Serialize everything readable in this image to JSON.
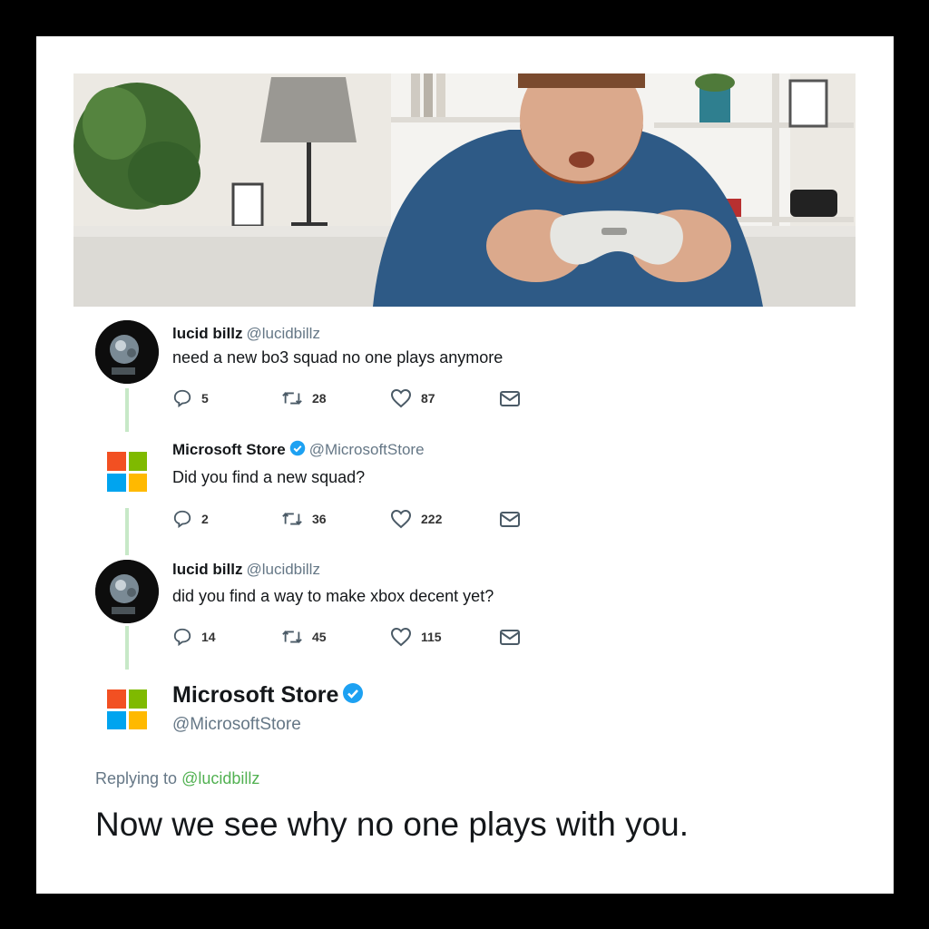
{
  "tweets": [
    {
      "name": "lucid billz",
      "handle": "@lucidbillz",
      "text": "need a new bo3 squad no one plays anymore",
      "replies": "5",
      "retweets": "28",
      "likes": "87"
    },
    {
      "name": "Microsoft Store",
      "handle": "@MicrosoftStore",
      "text": "Did you find a new squad?",
      "replies": "2",
      "retweets": "36",
      "likes": "222"
    },
    {
      "name": "lucid billz",
      "handle": "@lucidbillz",
      "text": "did you find a way to make xbox decent yet?",
      "replies": "14",
      "retweets": "45",
      "likes": "115"
    }
  ],
  "final_tweet": {
    "name": "Microsoft Store",
    "handle": "@MicrosoftStore",
    "replying_label": "Replying to",
    "replying_mention": "@lucidbillz",
    "text": "Now we see why no one plays with you."
  },
  "avatar_badge": "BILLZ",
  "colors": {
    "ms_red": "#f25022",
    "ms_green": "#7fba00",
    "ms_blue": "#00a4ef",
    "ms_yellow": "#ffb900",
    "verified_blue": "#1da1f2",
    "thread_line": "#c7e8c7"
  },
  "icons": [
    "reply-icon",
    "retweet-icon",
    "like-icon",
    "dm-icon",
    "verified-icon",
    "microsoft-logo"
  ]
}
